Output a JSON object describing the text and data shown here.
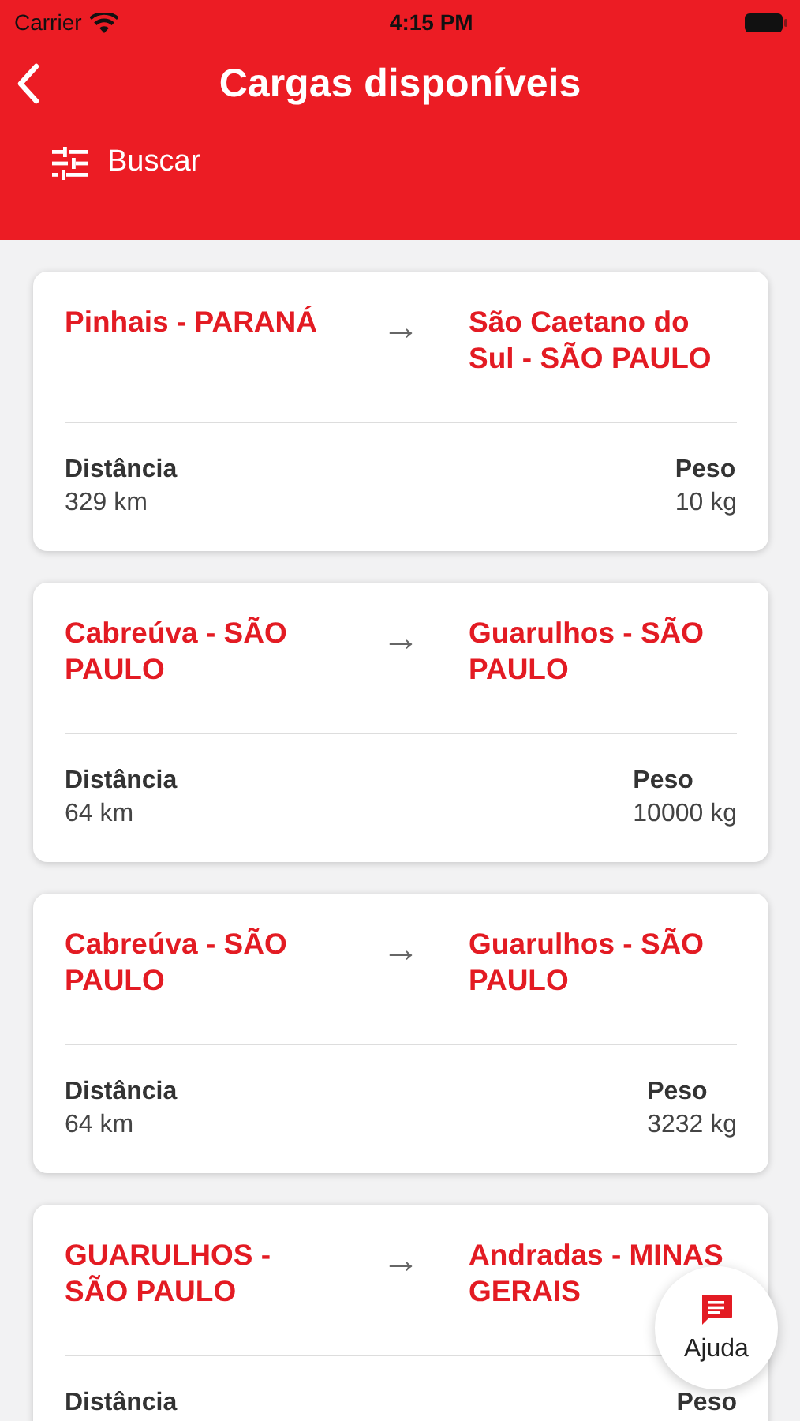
{
  "status_bar": {
    "carrier": "Carrier",
    "time": "4:15 PM"
  },
  "header": {
    "title": "Cargas disponíveis",
    "search_label": "Buscar"
  },
  "loads": [
    {
      "origin": "Pinhais - PARANÁ",
      "arrow": "→",
      "destination": "São Caetano do Sul - SÃO PAULO",
      "distance_label": "Distância",
      "distance": "329 km",
      "weight_label": "Peso",
      "weight": "10 kg"
    },
    {
      "origin": "Cabreúva - SÃO PAULO",
      "arrow": "→",
      "destination": "Guarulhos - SÃO PAULO",
      "distance_label": "Distância",
      "distance": "64 km",
      "weight_label": "Peso",
      "weight": "10000 kg"
    },
    {
      "origin": "Cabreúva - SÃO PAULO",
      "arrow": "→",
      "destination": "Guarulhos - SÃO PAULO",
      "distance_label": "Distância",
      "distance": "64 km",
      "weight_label": "Peso",
      "weight": "3232 kg"
    },
    {
      "origin": "GUARULHOS - SÃO PAULO",
      "arrow": "→",
      "destination": "Andradas - MINAS GERAIS",
      "distance_label": "Distância",
      "weight_label": "Peso"
    }
  ],
  "help_button": {
    "label": "Ajuda"
  }
}
